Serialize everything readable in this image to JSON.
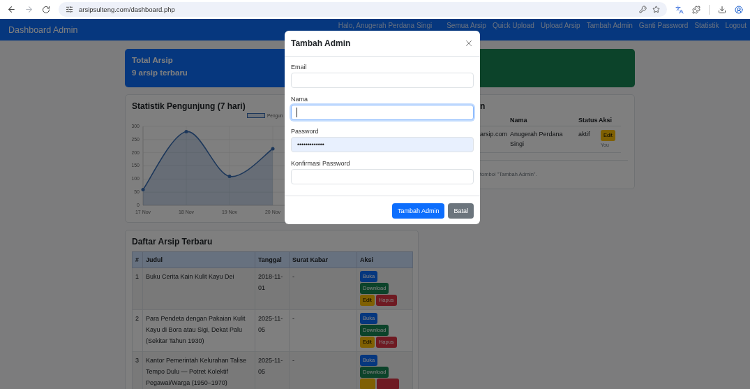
{
  "browser": {
    "url": "arsipsulteng.com/dashboard.php"
  },
  "navbar": {
    "brand": "Dashboard Admin",
    "greeting": "Halo, Anugerah Perdana Singi",
    "links": [
      "Semua Arsip",
      "Quick Upload",
      "Upload Arsip",
      "Tambah Admin",
      "Ganti Password",
      "Statistik",
      "Logout"
    ]
  },
  "summary_cards": [
    {
      "title": "Total Arsip",
      "subtitle": "9 arsip terbaru",
      "kind": "primary"
    },
    {
      "kind": "success"
    }
  ],
  "chart_card": {
    "title": "Statistik Pengunjung (7 hari)",
    "chart_data": {
      "type": "area",
      "categories": [
        "17 Nov",
        "18 Nov",
        "19 Nov",
        "20 Nov"
      ],
      "ylim": [
        0,
        300
      ],
      "yticks": [
        0,
        50,
        100,
        150,
        200,
        250,
        300
      ],
      "grid": true,
      "series": [
        {
          "name": "Pengun",
          "color": "#3a6fb5",
          "values": [
            60,
            280,
            110,
            215
          ]
        }
      ]
    }
  },
  "admin_card": {
    "title": "n",
    "columns": [
      "Nama",
      "Status",
      "Aksi"
    ],
    "rows": [
      {
        "email": "arsip.com",
        "name": "Anugerah Perdana Singi",
        "status": "aktif",
        "action": "Edit",
        "note": "You"
      }
    ],
    "footer": "tombol \"Tambah Admin\"."
  },
  "archive_card": {
    "title": "Daftar Arsip Terbaru",
    "columns": [
      "#",
      "Judul",
      "Tanggal",
      "Surat Kabar",
      "Aksi"
    ],
    "rows": [
      {
        "no": "1",
        "title": "Buku Cerita Kain Kulit Kayu Dei",
        "date": "2018-11-01",
        "newspaper": "-",
        "actions": [
          {
            "label": "Buka",
            "kind": "primary"
          },
          {
            "label": "Download",
            "kind": "success"
          },
          {
            "label": "Edit",
            "kind": "warning"
          },
          {
            "label": "Hapus",
            "kind": "danger"
          }
        ]
      },
      {
        "no": "2",
        "title": "Para Pendeta dengan Pakaian Kulit Kayu di Bora atau Sigi, Dekat Palu (Sekitar Tahun 1930)",
        "date": "2025-11-05",
        "newspaper": "-",
        "actions": [
          {
            "label": "Buka",
            "kind": "primary"
          },
          {
            "label": "Download",
            "kind": "success"
          },
          {
            "label": "Edit",
            "kind": "warning"
          },
          {
            "label": "Hapus",
            "kind": "danger"
          }
        ]
      },
      {
        "no": "3",
        "title": "Kantor Pemerintah Kelurahan Talise Tempo Dulu — Potret Kolektif Pegawai/Warga (1950–1970)",
        "date": "2025-11-05",
        "newspaper": "-",
        "actions": [
          {
            "label": "Buka",
            "kind": "primary"
          },
          {
            "label": "Download",
            "kind": "success"
          },
          {
            "kind": "warning"
          },
          {
            "kind": "danger"
          }
        ]
      }
    ]
  },
  "modal": {
    "title": "Tambah Admin",
    "fields": [
      {
        "label": "Email",
        "focused": false,
        "autofilled": false
      },
      {
        "label": "Nama",
        "focused": true,
        "autofilled": false
      },
      {
        "label": "Password",
        "value": "•••••••••••••",
        "focused": false,
        "autofilled": true
      },
      {
        "label": "Konfirmasi Password",
        "focused": false,
        "autofilled": false
      }
    ],
    "buttons": [
      {
        "label": "Tambah Admin",
        "kind": "primary"
      },
      {
        "label": "Batal",
        "kind": "secondary"
      }
    ]
  }
}
